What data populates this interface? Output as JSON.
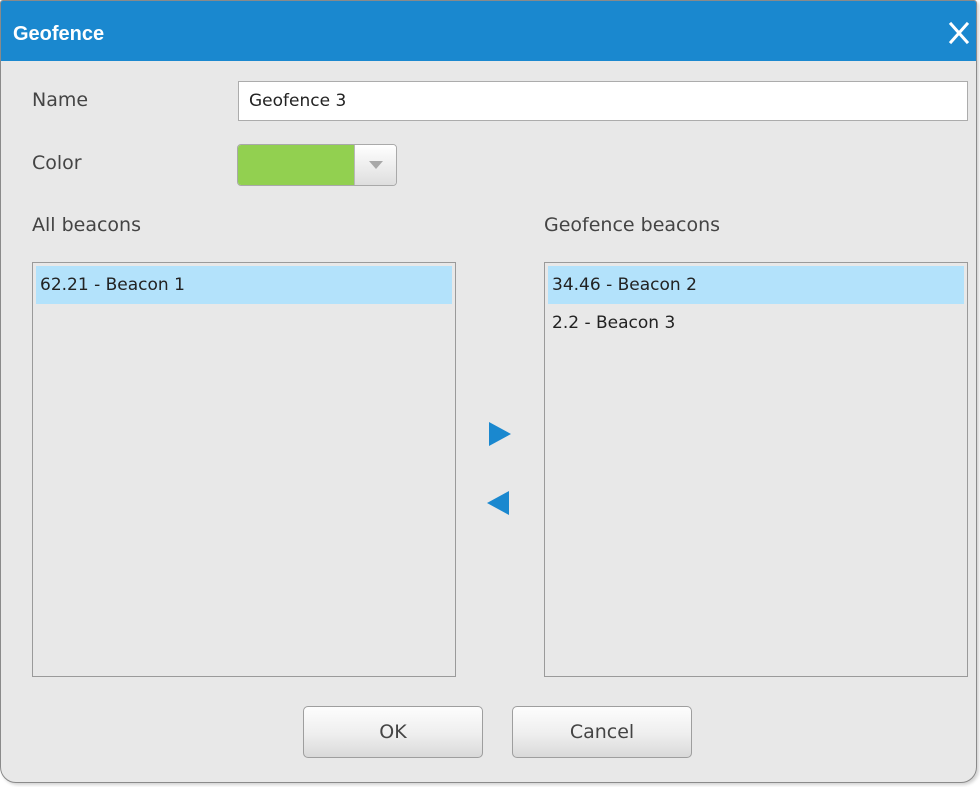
{
  "window": {
    "title": "Geofence"
  },
  "form": {
    "name_label": "Name",
    "name_value": "Geofence 3",
    "color_label": "Color",
    "color_value": "#92d050"
  },
  "lists": {
    "all_label": "All beacons",
    "geofence_label": "Geofence beacons",
    "all_items": [
      "62.21 - Beacon 1"
    ],
    "geofence_items": [
      "34.46 - Beacon 2",
      "2.2 - Beacon 3"
    ]
  },
  "buttons": {
    "ok": "OK",
    "cancel": "Cancel"
  },
  "theme": {
    "accent": "#1a88cf",
    "selection": "#b3e2fb",
    "arrow_color": "#1a88cf"
  }
}
